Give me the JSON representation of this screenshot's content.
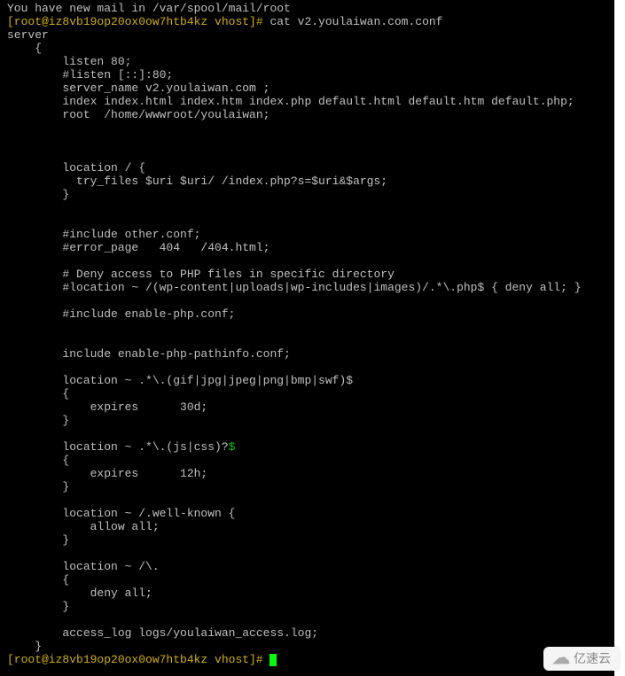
{
  "terminal": {
    "lines": [
      {
        "text": "You have new mail in /var/spool/mail/root",
        "cls": ""
      },
      {
        "prompt": "[root@iz8vb19op20ox0ow7htb4kz vhost]# ",
        "cmd": "cat v2.youlaiwan.com.conf"
      },
      {
        "text": "server",
        "cls": ""
      },
      {
        "text": "    {",
        "cls": ""
      },
      {
        "text": "        listen 80;",
        "cls": ""
      },
      {
        "text": "        #listen [::]:80;",
        "cls": ""
      },
      {
        "text": "        server_name v2.youlaiwan.com ;",
        "cls": ""
      },
      {
        "text": "        index index.html index.htm index.php default.html default.htm default.php;",
        "cls": ""
      },
      {
        "text": "        root  /home/wwwroot/youlaiwan;",
        "cls": ""
      },
      {
        "text": "",
        "cls": ""
      },
      {
        "text": "",
        "cls": ""
      },
      {
        "text": "",
        "cls": ""
      },
      {
        "text": "        location / {",
        "cls": ""
      },
      {
        "text": "          try_files $uri $uri/ /index.php?s=$uri&$args;",
        "cls": ""
      },
      {
        "text": "        }",
        "cls": ""
      },
      {
        "text": "",
        "cls": ""
      },
      {
        "text": "",
        "cls": ""
      },
      {
        "text": "        #include other.conf;",
        "cls": ""
      },
      {
        "text": "        #error_page   404   /404.html;",
        "cls": ""
      },
      {
        "text": "",
        "cls": ""
      },
      {
        "text": "        # Deny access to PHP files in specific directory",
        "cls": ""
      },
      {
        "text": "        #location ~ /(wp-content|uploads|wp-includes|images)/.*\\.php$ { deny all; }",
        "cls": ""
      },
      {
        "text": "",
        "cls": ""
      },
      {
        "text": "        #include enable-php.conf;",
        "cls": ""
      },
      {
        "text": "",
        "cls": ""
      },
      {
        "text": "",
        "cls": ""
      },
      {
        "text": "        include enable-php-pathinfo.conf;",
        "cls": ""
      },
      {
        "text": "",
        "cls": ""
      },
      {
        "text": "        location ~ .*\\.(gif|jpg|jpeg|png|bmp|swf)$",
        "cls": ""
      },
      {
        "text": "        {",
        "cls": ""
      },
      {
        "text": "            expires      30d;",
        "cls": ""
      },
      {
        "text": "        }",
        "cls": ""
      },
      {
        "text": "",
        "cls": ""
      },
      {
        "segments": [
          {
            "t": "        location ~ .*\\.(js|css)?",
            "cls": ""
          },
          {
            "t": "$",
            "cls": "green"
          }
        ]
      },
      {
        "text": "        {",
        "cls": ""
      },
      {
        "text": "            expires      12h;",
        "cls": ""
      },
      {
        "text": "        }",
        "cls": ""
      },
      {
        "text": "",
        "cls": ""
      },
      {
        "text": "        location ~ /.well-known {",
        "cls": ""
      },
      {
        "text": "            allow all;",
        "cls": ""
      },
      {
        "text": "        }",
        "cls": ""
      },
      {
        "text": "",
        "cls": ""
      },
      {
        "text": "        location ~ /\\.",
        "cls": ""
      },
      {
        "text": "        {",
        "cls": ""
      },
      {
        "text": "            deny all;",
        "cls": ""
      },
      {
        "text": "        }",
        "cls": ""
      },
      {
        "text": "",
        "cls": ""
      },
      {
        "text": "        access_log logs/youlaiwan_access.log;",
        "cls": ""
      },
      {
        "text": "    }",
        "cls": ""
      }
    ],
    "final_prompt": "[root@iz8vb19op20ox0ow7htb4kz vhost]# "
  },
  "watermark": {
    "text": "亿速云"
  }
}
